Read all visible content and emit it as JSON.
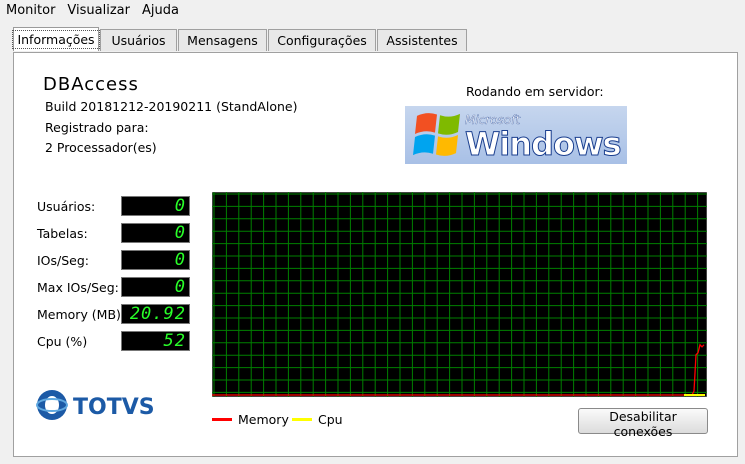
{
  "menubar": {
    "items": [
      "Monitor",
      "Visualizar",
      "Ajuda"
    ]
  },
  "tabs": [
    {
      "label": "Informações",
      "active": true
    },
    {
      "label": "Usuários",
      "active": false
    },
    {
      "label": "Mensagens",
      "active": false
    },
    {
      "label": "Configurações",
      "active": false
    },
    {
      "label": "Assistentes",
      "active": false
    }
  ],
  "app": {
    "title": "DBAccess",
    "build": "Build 20181212-20190211 (StandAlone)",
    "registered_label": "Registrado para:",
    "processors": "2 Processador(es)"
  },
  "server": {
    "label": "Rodando em servidor:",
    "logo_microsoft": "Microsoft",
    "logo_windows": "Windows"
  },
  "stats": [
    {
      "label": "Usuários:",
      "value": "0"
    },
    {
      "label": "Tabelas:",
      "value": "0"
    },
    {
      "label": "IOs/Seg:",
      "value": "0"
    },
    {
      "label": "Max IOs/Seg:",
      "value": "0"
    },
    {
      "label": "Memory (MB)",
      "value": "20.92"
    },
    {
      "label": "Cpu (%)",
      "value": "52"
    }
  ],
  "graph": {
    "background": "#000000",
    "grid_color": "#008000",
    "memory_color": "#ff0000",
    "cpu_color": "#ffff00",
    "memory_series": [
      0,
      0,
      0,
      0,
      0,
      0,
      0,
      0,
      0,
      0,
      0,
      0,
      0,
      0,
      0,
      0,
      0,
      0,
      0,
      0,
      0,
      0,
      0,
      0,
      0,
      0,
      0,
      0,
      0,
      0,
      0,
      0,
      0,
      0,
      0,
      0,
      0,
      0,
      0,
      0,
      0,
      0,
      0,
      0,
      0,
      0,
      0,
      0,
      0,
      0,
      0,
      0,
      0,
      0,
      0,
      0,
      0,
      0,
      0,
      0,
      0,
      0,
      0,
      0,
      0,
      0,
      0,
      0,
      0,
      0,
      0,
      0,
      0,
      0,
      0,
      0,
      0,
      0,
      0,
      0,
      0,
      0,
      0,
      0,
      0,
      0,
      0,
      0,
      0,
      0,
      0,
      0,
      0,
      0,
      0,
      0,
      0,
      0,
      0,
      0,
      0,
      0,
      0,
      0,
      0,
      0,
      0,
      0,
      0,
      0,
      0,
      0,
      0,
      0,
      0,
      0,
      0,
      0,
      0,
      0,
      0,
      0,
      0,
      0,
      0,
      0,
      0,
      0,
      0,
      0,
      0,
      0,
      0,
      0,
      0,
      0,
      0,
      0,
      0,
      0,
      0,
      0,
      0,
      0,
      0,
      0,
      0,
      0,
      0,
      0,
      0,
      0,
      0,
      0,
      0,
      0,
      0,
      0,
      0,
      0,
      0,
      0,
      0,
      0,
      0,
      0,
      0,
      0,
      0,
      0,
      0,
      0,
      0,
      0,
      0,
      0,
      0,
      0,
      0,
      0,
      0,
      0,
      0,
      0,
      0,
      0,
      0,
      0,
      0,
      0,
      0,
      0,
      0,
      0,
      0,
      0,
      0,
      0,
      0,
      0,
      0,
      0,
      0,
      0,
      0,
      0,
      0,
      0,
      0,
      0,
      0,
      0,
      0,
      0,
      0,
      0,
      0,
      0,
      0,
      0,
      0,
      0,
      0,
      0,
      0,
      0,
      0,
      0,
      0,
      0,
      0,
      0,
      0,
      0,
      0,
      0,
      0,
      0,
      0,
      0,
      0,
      2,
      20,
      21,
      25,
      24,
      25
    ],
    "cpu_series_level": 0
  },
  "legend": [
    {
      "label": "Memory",
      "color": "#ff0000"
    },
    {
      "label": "Cpu",
      "color": "#ffff00"
    }
  ],
  "brand": {
    "name": "TOTVS",
    "color": "#1c5aa6"
  },
  "button": {
    "label": "Desabilitar conexões"
  }
}
